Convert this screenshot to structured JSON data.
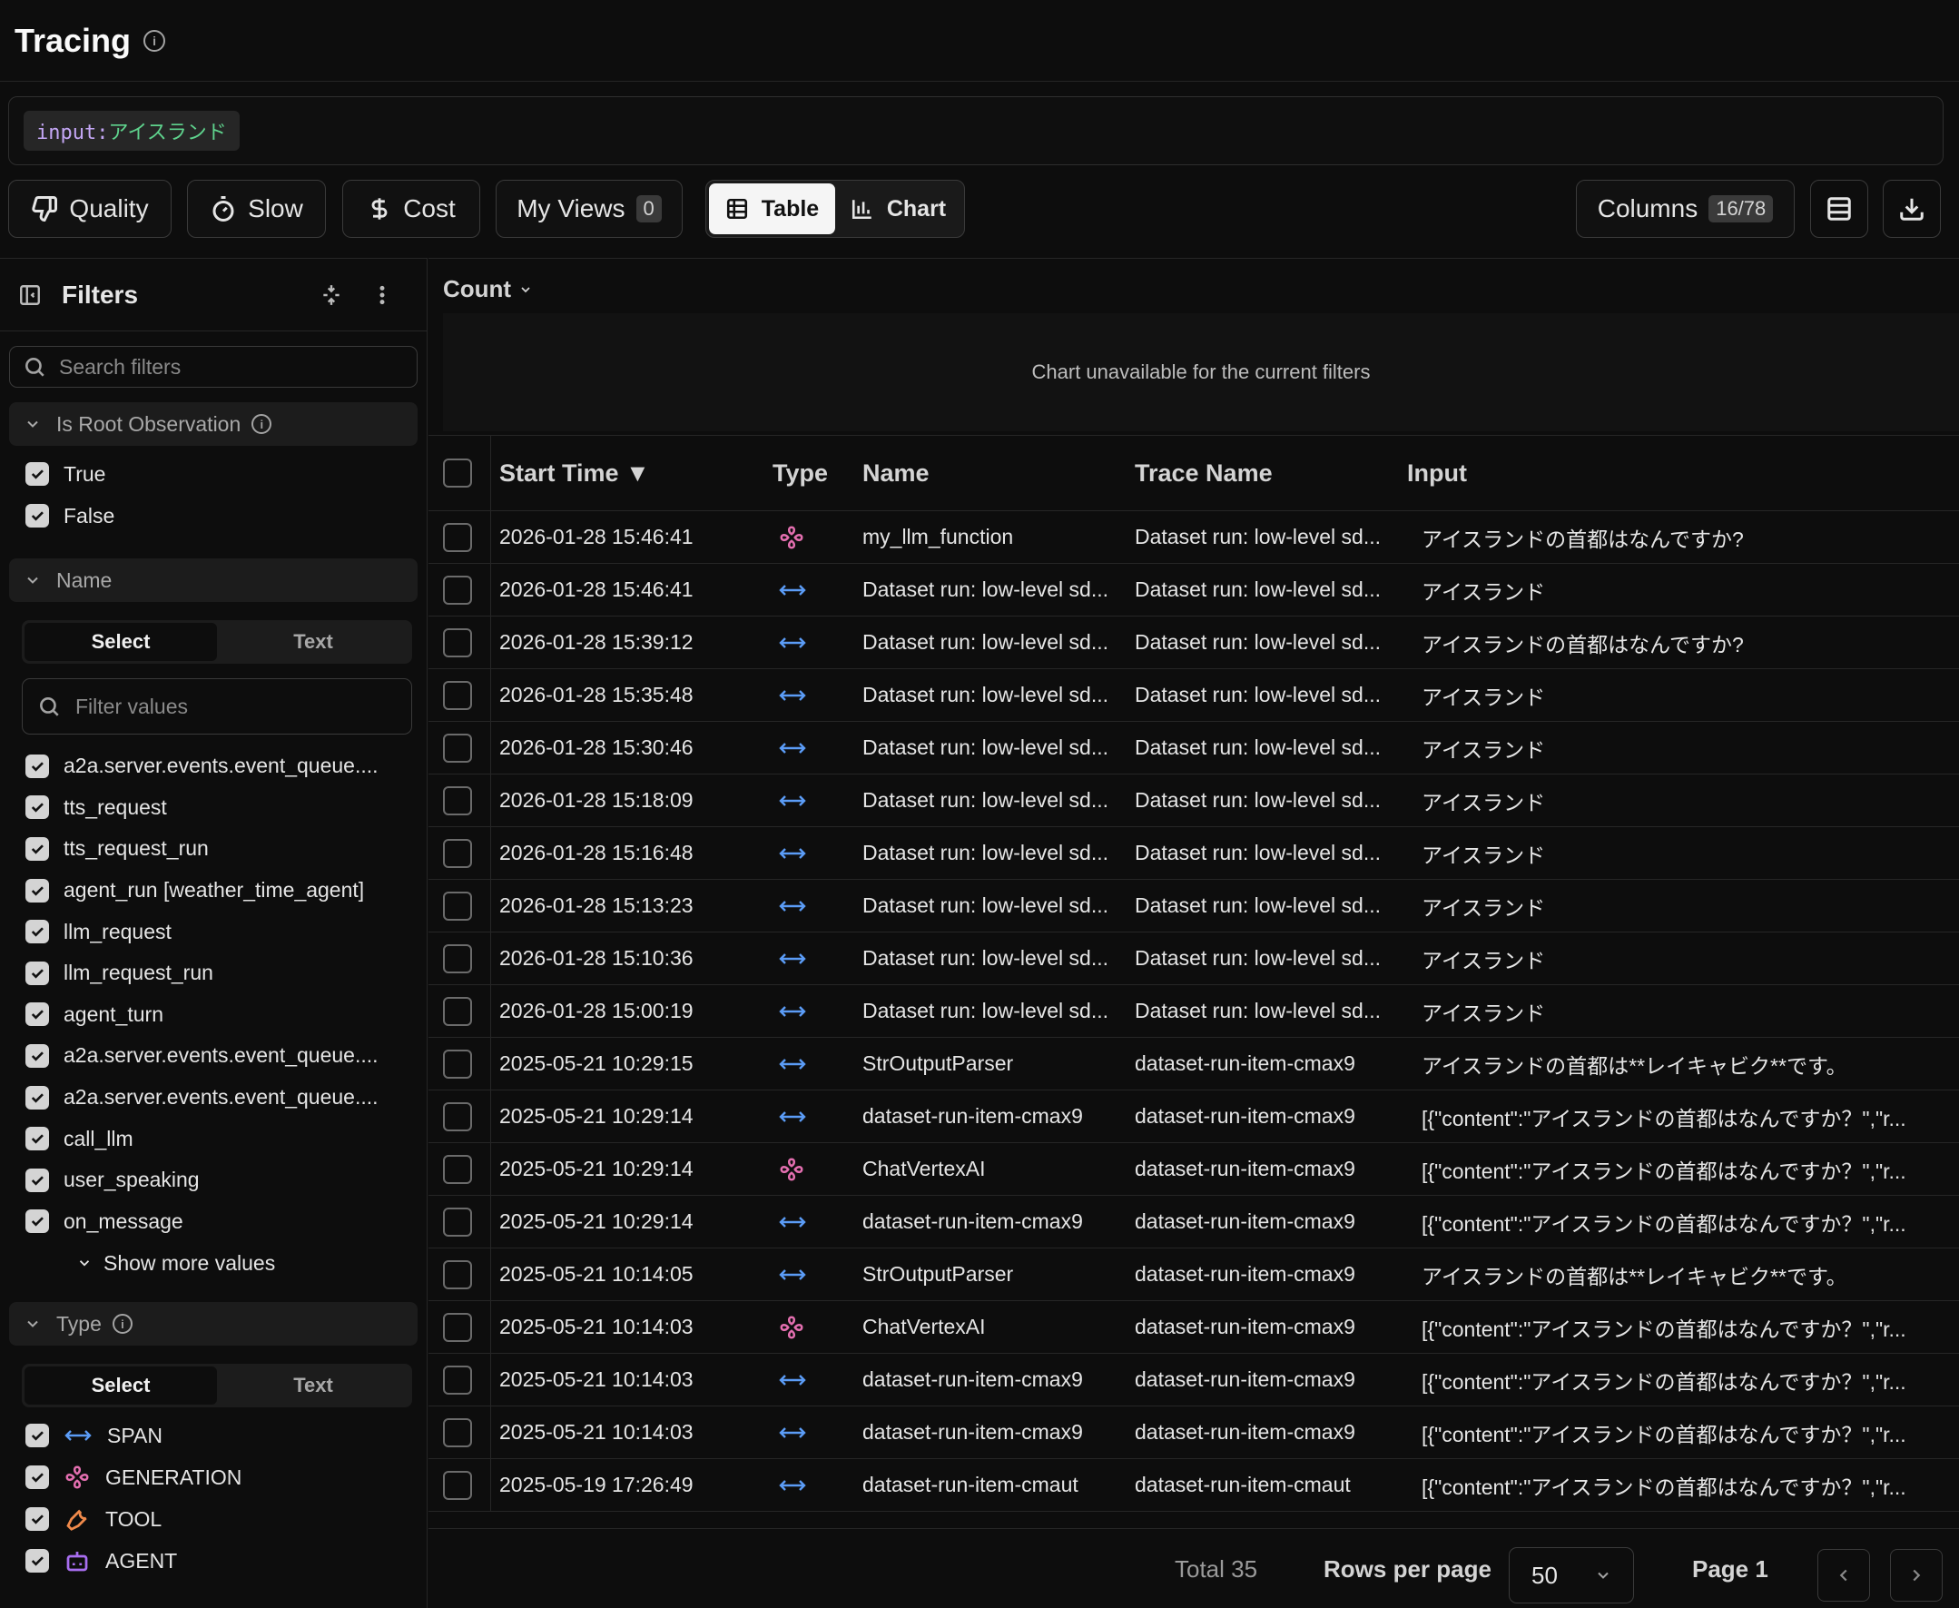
{
  "header": {
    "title": "Tracing"
  },
  "search": {
    "key": "input",
    "sep": ":",
    "value": "アイスランド"
  },
  "toolbar": {
    "quality": "Quality",
    "slow": "Slow",
    "cost": "Cost",
    "my_views": "My Views",
    "my_views_count": "0",
    "table": "Table",
    "chart": "Chart",
    "columns": "Columns",
    "columns_count": "16/78"
  },
  "sidebar": {
    "title": "Filters",
    "search_placeholder": "Search filters",
    "root_section": "Is Root Observation",
    "root_values": [
      "True",
      "False"
    ],
    "name_section": "Name",
    "mode_select": "Select",
    "mode_text": "Text",
    "filter_values_placeholder": "Filter values",
    "name_values": [
      "a2a.server.events.event_queue....",
      "tts_request",
      "tts_request_run",
      "agent_run [weather_time_agent]",
      "llm_request",
      "llm_request_run",
      "agent_turn",
      "a2a.server.events.event_queue....",
      "a2a.server.events.event_queue....",
      "call_llm",
      "user_speaking",
      "on_message"
    ],
    "show_more": "Show more values",
    "type_section": "Type",
    "type_values": [
      "SPAN",
      "GENERATION",
      "TOOL",
      "AGENT"
    ]
  },
  "chart": {
    "metric": "Count",
    "empty_message": "Chart unavailable for the current filters"
  },
  "table": {
    "columns": [
      "Start Time ▼",
      "Type",
      "Name",
      "Trace Name",
      "Input"
    ],
    "rows": [
      {
        "time": "2026-01-28 15:46:41",
        "type": "generation",
        "name": "my_llm_function",
        "trace": "Dataset run: low-level sd...",
        "input": "アイスランドの首都はなんですか?"
      },
      {
        "time": "2026-01-28 15:46:41",
        "type": "span",
        "name": "Dataset run: low-level sd...",
        "trace": "Dataset run: low-level sd...",
        "input": "アイスランド"
      },
      {
        "time": "2026-01-28 15:39:12",
        "type": "span",
        "name": "Dataset run: low-level sd...",
        "trace": "Dataset run: low-level sd...",
        "input": "アイスランドの首都はなんですか?"
      },
      {
        "time": "2026-01-28 15:35:48",
        "type": "span",
        "name": "Dataset run: low-level sd...",
        "trace": "Dataset run: low-level sd...",
        "input": "アイスランド"
      },
      {
        "time": "2026-01-28 15:30:46",
        "type": "span",
        "name": "Dataset run: low-level sd...",
        "trace": "Dataset run: low-level sd...",
        "input": "アイスランド"
      },
      {
        "time": "2026-01-28 15:18:09",
        "type": "span",
        "name": "Dataset run: low-level sd...",
        "trace": "Dataset run: low-level sd...",
        "input": "アイスランド"
      },
      {
        "time": "2026-01-28 15:16:48",
        "type": "span",
        "name": "Dataset run: low-level sd...",
        "trace": "Dataset run: low-level sd...",
        "input": "アイスランド"
      },
      {
        "time": "2026-01-28 15:13:23",
        "type": "span",
        "name": "Dataset run: low-level sd...",
        "trace": "Dataset run: low-level sd...",
        "input": "アイスランド"
      },
      {
        "time": "2026-01-28 15:10:36",
        "type": "span",
        "name": "Dataset run: low-level sd...",
        "trace": "Dataset run: low-level sd...",
        "input": "アイスランド"
      },
      {
        "time": "2026-01-28 15:00:19",
        "type": "span",
        "name": "Dataset run: low-level sd...",
        "trace": "Dataset run: low-level sd...",
        "input": "アイスランド"
      },
      {
        "time": "2025-05-21 10:29:15",
        "type": "span",
        "name": "StrOutputParser",
        "trace": "dataset-run-item-cmax9",
        "input": "アイスランドの首都は**レイキャビク**です。"
      },
      {
        "time": "2025-05-21 10:29:14",
        "type": "span",
        "name": "dataset-run-item-cmax9",
        "trace": "dataset-run-item-cmax9",
        "input": "[{\"content\":\"アイスランドの首都はなんですか？\",\"r..."
      },
      {
        "time": "2025-05-21 10:29:14",
        "type": "generation",
        "name": "ChatVertexAI",
        "trace": "dataset-run-item-cmax9",
        "input": "[{\"content\":\"アイスランドの首都はなんですか？\",\"r..."
      },
      {
        "time": "2025-05-21 10:29:14",
        "type": "span",
        "name": "dataset-run-item-cmax9",
        "trace": "dataset-run-item-cmax9",
        "input": "[{\"content\":\"アイスランドの首都はなんですか？\",\"r..."
      },
      {
        "time": "2025-05-21 10:14:05",
        "type": "span",
        "name": "StrOutputParser",
        "trace": "dataset-run-item-cmax9",
        "input": "アイスランドの首都は**レイキャビク**です。"
      },
      {
        "time": "2025-05-21 10:14:03",
        "type": "generation",
        "name": "ChatVertexAI",
        "trace": "dataset-run-item-cmax9",
        "input": "[{\"content\":\"アイスランドの首都はなんですか？\",\"r..."
      },
      {
        "time": "2025-05-21 10:14:03",
        "type": "span",
        "name": "dataset-run-item-cmax9",
        "trace": "dataset-run-item-cmax9",
        "input": "[{\"content\":\"アイスランドの首都はなんですか？\",\"r..."
      },
      {
        "time": "2025-05-21 10:14:03",
        "type": "span",
        "name": "dataset-run-item-cmax9",
        "trace": "dataset-run-item-cmax9",
        "input": "[{\"content\":\"アイスランドの首都はなんですか？\",\"r..."
      },
      {
        "time": "2025-05-19 17:26:49",
        "type": "span",
        "name": "dataset-run-item-cmaut",
        "trace": "dataset-run-item-cmaut",
        "input": "[{\"content\":\"アイスランドの首都はなんですか？\",\"r..."
      }
    ]
  },
  "pagination": {
    "total": "Total 35",
    "rows_per_page_label": "Rows per page",
    "rows_per_page": "50",
    "page": "Page 1"
  },
  "colors": {
    "span": "#5b9cf6",
    "generation": "#e46fb0",
    "tool": "#f08a4b",
    "agent": "#a86ef0"
  }
}
